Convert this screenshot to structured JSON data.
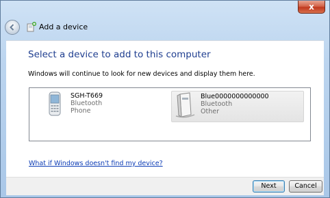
{
  "window": {
    "title": "Add a device",
    "close_glyph": "x"
  },
  "main": {
    "heading": "Select a device to add to this computer",
    "subtext": "Windows will continue to look for new devices and display them here.",
    "devices": [
      {
        "name": "SGH-T669",
        "type": "Bluetooth",
        "category": "Phone",
        "icon": "phone-icon"
      },
      {
        "name": "Blue0000000000000",
        "type": "Bluetooth",
        "category": "Other",
        "icon": "generic-device-icon"
      }
    ],
    "help_link": "What if Windows doesn't find my device?"
  },
  "footer": {
    "next_label": "Next",
    "cancel_label": "Cancel"
  }
}
